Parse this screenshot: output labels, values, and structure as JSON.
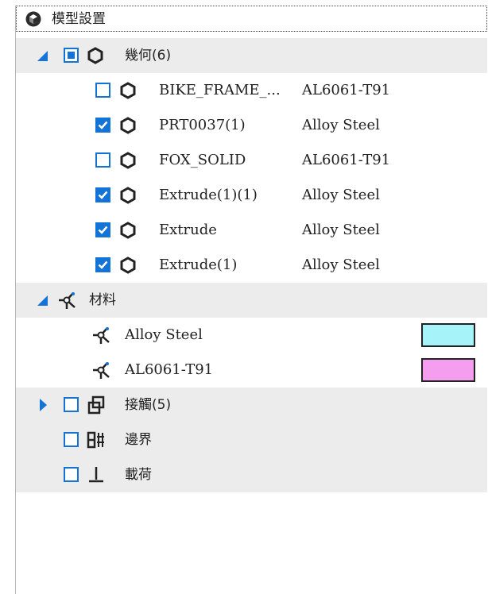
{
  "header": {
    "title": "模型設置",
    "icon": "cube-icon"
  },
  "geometry": {
    "label": "幾何(6)",
    "items": [
      {
        "name": "BIKE_FRAME_...",
        "material": "AL6061-T91",
        "checked": false
      },
      {
        "name": "PRT0037(1)",
        "material": "Alloy Steel",
        "checked": true
      },
      {
        "name": "FOX_SOLID",
        "material": "AL6061-T91",
        "checked": false
      },
      {
        "name": "Extrude(1)(1)",
        "material": "Alloy Steel",
        "checked": true
      },
      {
        "name": "Extrude",
        "material": "Alloy Steel",
        "checked": true
      },
      {
        "name": "Extrude(1)",
        "material": "Alloy Steel",
        "checked": true
      }
    ]
  },
  "materials": {
    "label": "材料",
    "items": [
      {
        "name": "Alloy Steel",
        "color": "#a6f4fa"
      },
      {
        "name": "AL6061-T91",
        "color": "#f59ef0"
      }
    ]
  },
  "contacts": {
    "label": "接觸(5)"
  },
  "boundary": {
    "label": "邊界"
  },
  "loads": {
    "label": "載荷"
  },
  "colors": {
    "accent": "#1473d6",
    "row_shade": "#ececec"
  }
}
